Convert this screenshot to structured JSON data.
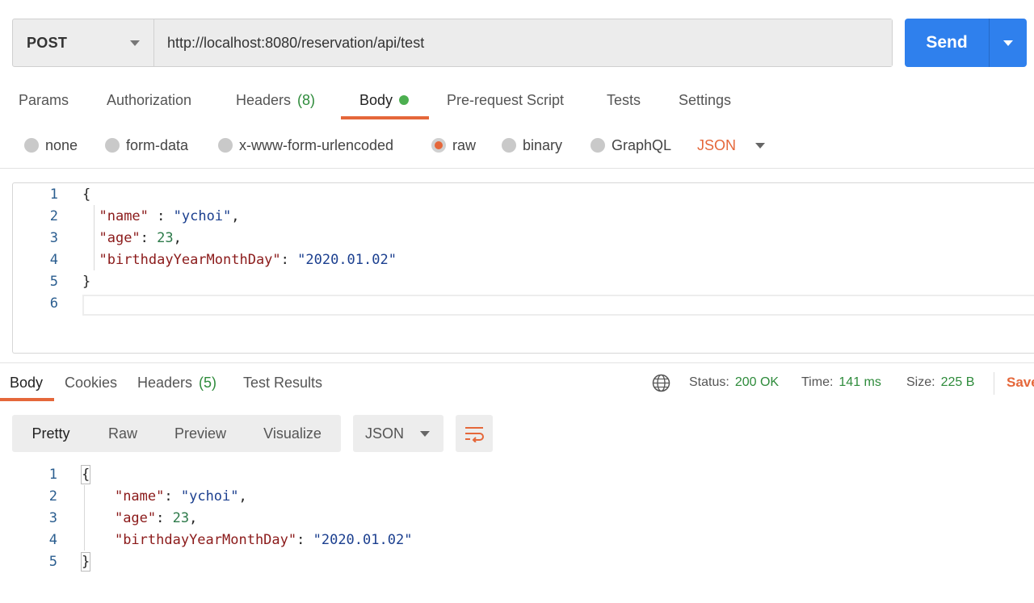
{
  "request": {
    "method": "POST",
    "url": "http://localhost:8080/reservation/api/test",
    "send_label": "Send"
  },
  "request_tabs": [
    {
      "label": "Params"
    },
    {
      "label": "Authorization"
    },
    {
      "label": "Headers",
      "count": "(8)"
    },
    {
      "label": "Body",
      "active": true,
      "indicator": "green-dot"
    },
    {
      "label": "Pre-request Script"
    },
    {
      "label": "Tests"
    },
    {
      "label": "Settings"
    }
  ],
  "body_types": [
    {
      "label": "none"
    },
    {
      "label": "form-data"
    },
    {
      "label": "x-www-form-urlencoded"
    },
    {
      "label": "raw",
      "checked": true
    },
    {
      "label": "binary"
    },
    {
      "label": "GraphQL"
    }
  ],
  "raw_format": "JSON",
  "request_body_lines": [
    {
      "n": "1",
      "text": "{"
    },
    {
      "n": "2",
      "text": "  \"name\" : \"ychoi\","
    },
    {
      "n": "3",
      "text": "  \"age\": 23,"
    },
    {
      "n": "4",
      "text": "  \"birthdayYearMonthDay\": \"2020.01.02\""
    },
    {
      "n": "5",
      "text": "}"
    },
    {
      "n": "6",
      "text": ""
    }
  ],
  "response_tabs": [
    {
      "label": "Body",
      "active": true
    },
    {
      "label": "Cookies"
    },
    {
      "label": "Headers",
      "count": "(5)"
    },
    {
      "label": "Test Results"
    }
  ],
  "response_meta": {
    "status_label": "Status:",
    "status_value": "200 OK",
    "time_label": "Time:",
    "time_value": "141 ms",
    "size_label": "Size:",
    "size_value": "225 B",
    "save_label": "Save"
  },
  "view_modes": [
    {
      "label": "Pretty",
      "active": true
    },
    {
      "label": "Raw"
    },
    {
      "label": "Preview"
    },
    {
      "label": "Visualize"
    }
  ],
  "response_format": "JSON",
  "response_body_lines": [
    {
      "n": "1",
      "text": "{"
    },
    {
      "n": "2",
      "text": "    \"name\": \"ychoi\","
    },
    {
      "n": "3",
      "text": "    \"age\": 23,"
    },
    {
      "n": "4",
      "text": "    \"birthdayYearMonthDay\": \"2020.01.02\""
    },
    {
      "n": "5",
      "text": "}"
    }
  ],
  "colors": {
    "accent": "#e5673a",
    "send": "#2f80ed",
    "success": "#2e8b3b",
    "json_key": "#8b1a1a",
    "json_string": "#1b3f8f",
    "json_number": "#2d7a4a"
  },
  "icons": {
    "method_dropdown": "chevron-down-icon",
    "send_dropdown": "chevron-down-icon",
    "globe": "globe-icon",
    "wrap": "wrap-lines-icon"
  }
}
